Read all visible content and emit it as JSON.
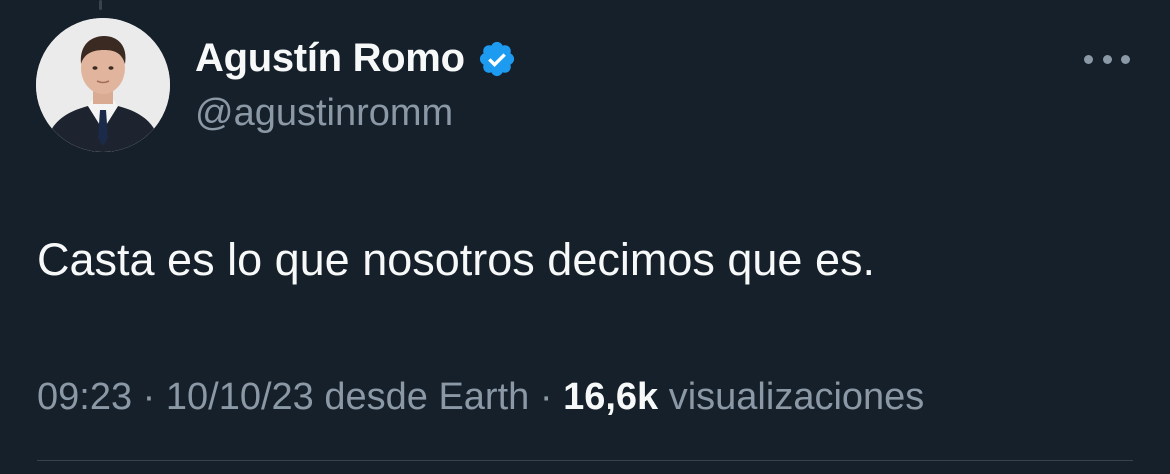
{
  "tweet": {
    "author": {
      "display_name": "Agustín Romo",
      "handle": "@agustinromm",
      "verified": true,
      "verified_badge_color": "#1d9bf0"
    },
    "text": "Casta es lo que nosotros decimos que es.",
    "meta": {
      "time": "09:23",
      "separator": "·",
      "date": "10/10/23",
      "source": "desde Earth",
      "views_count": "16,6k",
      "views_label": "visualizaciones"
    }
  },
  "icons": {
    "more": "more-horizontal-icon",
    "verified": "verified-badge-icon"
  },
  "theme": {
    "background": "#15202b",
    "primary_text": "#f7f9f9",
    "secondary_text": "#8b98a5",
    "divider": "#38444d"
  }
}
